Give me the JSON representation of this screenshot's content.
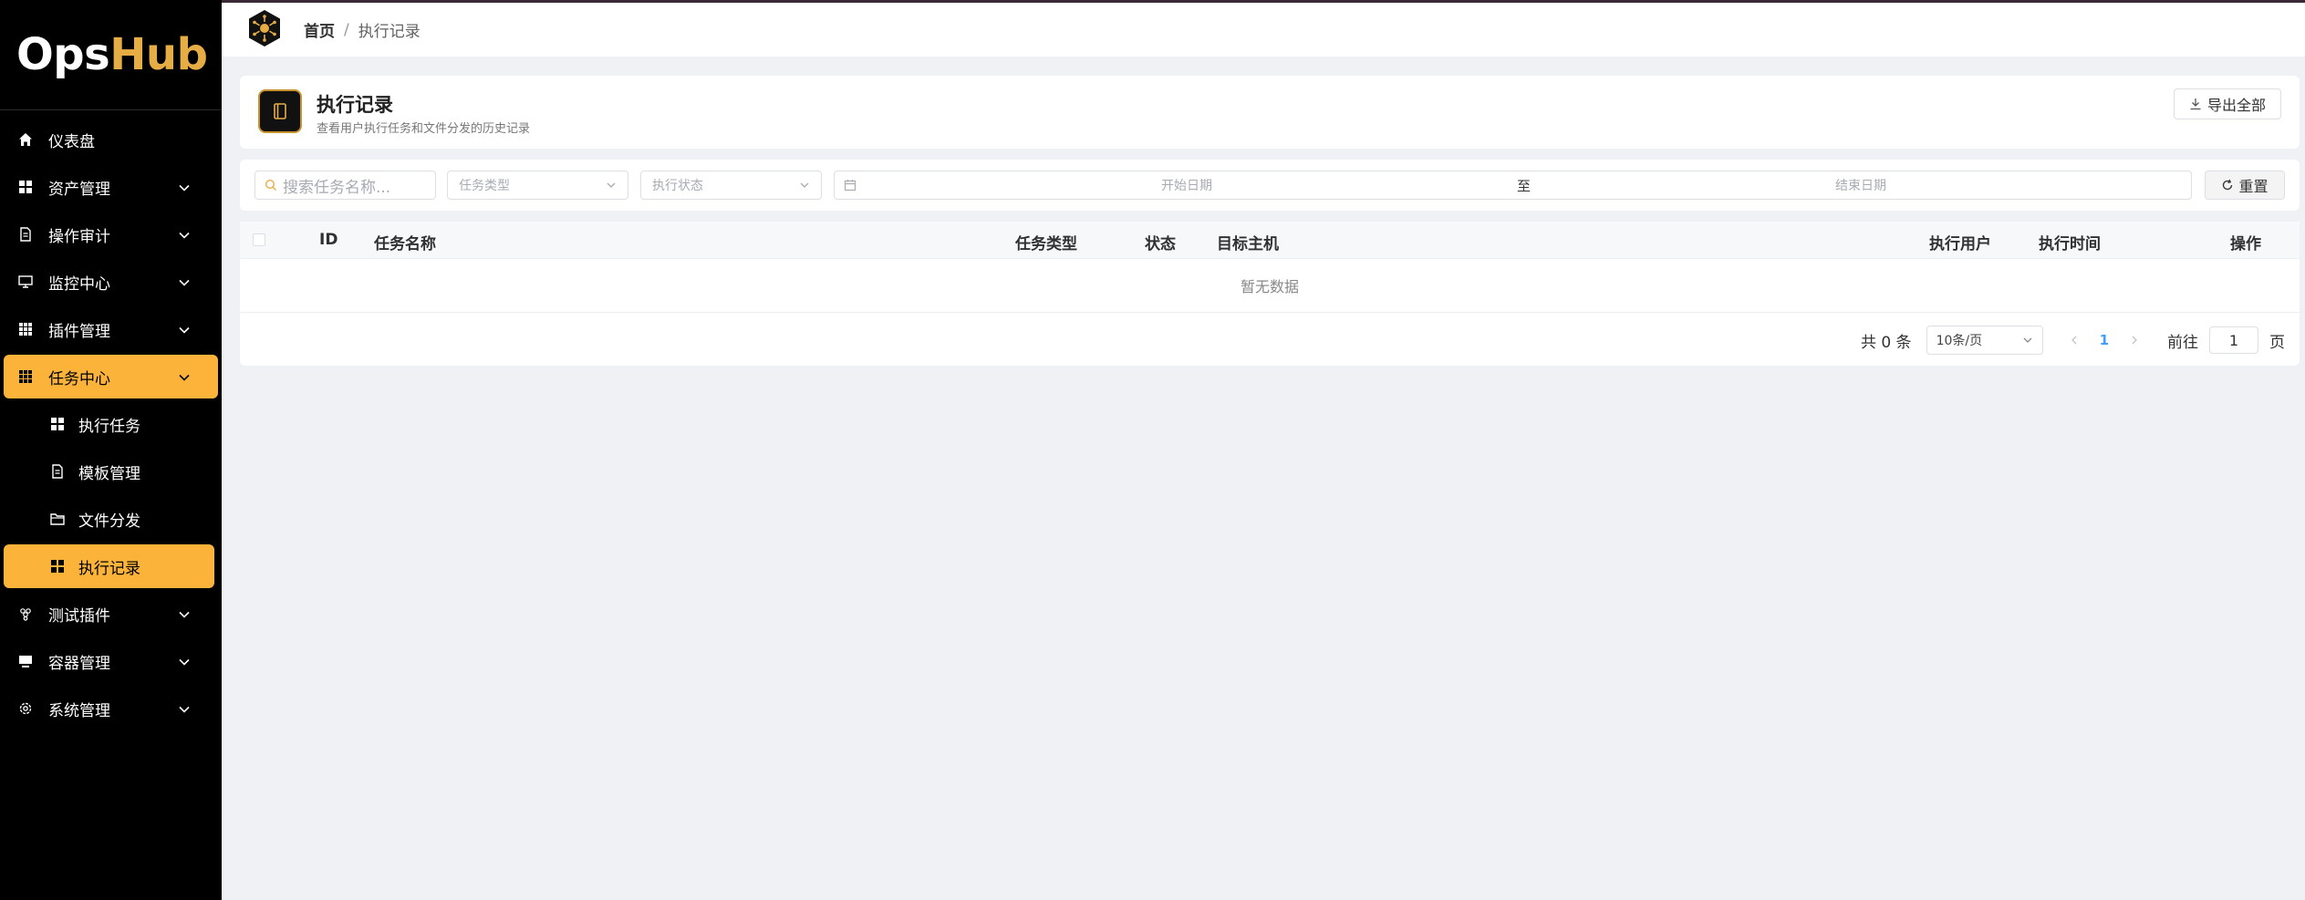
{
  "app": {
    "logo_part1": "Ops",
    "logo_part2": "Hub",
    "accent_color": "#fbb439"
  },
  "sidebar": {
    "items": [
      {
        "label": "仪表盘",
        "icon": "home-icon"
      },
      {
        "label": "资产管理",
        "icon": "grid-icon"
      },
      {
        "label": "操作审计",
        "icon": "document-icon"
      },
      {
        "label": "监控中心",
        "icon": "monitor-icon"
      },
      {
        "label": "插件管理",
        "icon": "apps-icon"
      },
      {
        "label": "任务中心",
        "icon": "apps-icon"
      },
      {
        "label": "测试插件",
        "icon": "grape-icon"
      },
      {
        "label": "容器管理",
        "icon": "computer-icon"
      },
      {
        "label": "系统管理",
        "icon": "gear-icon"
      }
    ],
    "sub_items": [
      {
        "label": "执行任务",
        "icon": "grid-icon"
      },
      {
        "label": "模板管理",
        "icon": "document-icon"
      },
      {
        "label": "文件分发",
        "icon": "folder-icon"
      },
      {
        "label": "执行记录",
        "icon": "grid-icon"
      }
    ]
  },
  "breadcrumb": {
    "home": "首页",
    "separator": "/",
    "current": "执行记录"
  },
  "header": {
    "title": "执行记录",
    "subtitle": "查看用户执行任务和文件分发的历史记录",
    "export_label": "导出全部"
  },
  "filters": {
    "search_placeholder": "搜索任务名称...",
    "type_placeholder": "任务类型",
    "status_placeholder": "执行状态",
    "start_date_placeholder": "开始日期",
    "range_separator": "至",
    "end_date_placeholder": "结束日期",
    "reset_label": "重置"
  },
  "table": {
    "columns": [
      "ID",
      "任务名称",
      "任务类型",
      "状态",
      "目标主机",
      "执行用户",
      "执行时间",
      "操作"
    ],
    "empty_text": "暂无数据"
  },
  "pagination": {
    "total_text": "共 0 条",
    "page_size": "10条/页",
    "current_page": "1",
    "goto_label": "前往",
    "goto_value": "1",
    "page_suffix": "页"
  }
}
